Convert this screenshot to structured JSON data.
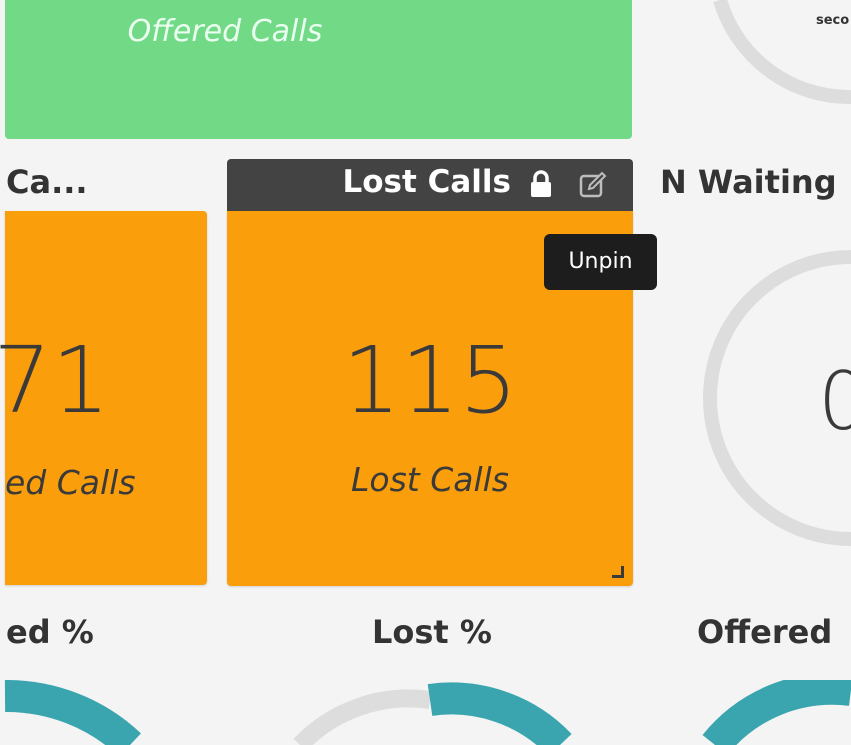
{
  "top_widget": {
    "caption": "Offered Calls"
  },
  "top_right_gauge": {
    "unit_text": "seco"
  },
  "headers": {
    "left": "Ca...",
    "middle": "Lost Calls",
    "right": "N Waiting"
  },
  "tiles": {
    "left": {
      "value": "71",
      "caption": "ed Calls"
    },
    "lost": {
      "value": "115",
      "caption": "Lost Calls"
    }
  },
  "right_gauge": {
    "value": "0"
  },
  "tooltip": {
    "text": "Unpin"
  },
  "bottom_headers": {
    "left": "ed %",
    "middle": "Lost %",
    "right": "Offered"
  },
  "colors": {
    "green": "#72da86",
    "orange": "#fa9e0b",
    "header_dark": "#434343",
    "teal": "#3aa5ae",
    "gauge_gray": "#dddddd"
  },
  "icons": {
    "lock": "lock-icon",
    "edit": "edit-icon",
    "resize": "resize-grip-icon"
  }
}
